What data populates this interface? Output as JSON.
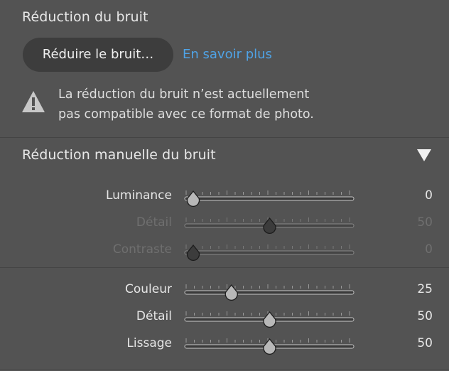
{
  "noise_reduction": {
    "title": "Réduction du bruit",
    "button_label": "Réduire le bruit…",
    "learn_more": "En savoir plus",
    "warning_line1": "La réduction du bruit n’est actuellement",
    "warning_line2": "pas compatible avec ce format de photo.",
    "warning_icon": "warning-triangle-icon"
  },
  "manual": {
    "title": "Réduction manuelle du bruit",
    "collapse_icon": "triangle-down-icon",
    "luminance_group": [
      {
        "label": "Luminance",
        "value": "0",
        "fraction": 0.0,
        "enabled": true
      },
      {
        "label": "Détail",
        "value": "50",
        "fraction": 0.5,
        "enabled": false
      },
      {
        "label": "Contraste",
        "value": "0",
        "fraction": 0.0,
        "enabled": false
      }
    ],
    "color_group": [
      {
        "label": "Couleur",
        "value": "25",
        "fraction": 0.25,
        "enabled": true
      },
      {
        "label": "Détail",
        "value": "50",
        "fraction": 0.5,
        "enabled": true
      },
      {
        "label": "Lissage",
        "value": "50",
        "fraction": 0.5,
        "enabled": true
      }
    ]
  },
  "colors": {
    "panel_bg": "#535353",
    "button_bg": "#3d3d3d",
    "link": "#4fa3e6",
    "text": "#e6e6e6",
    "dim_text": "#6f6f6f"
  }
}
